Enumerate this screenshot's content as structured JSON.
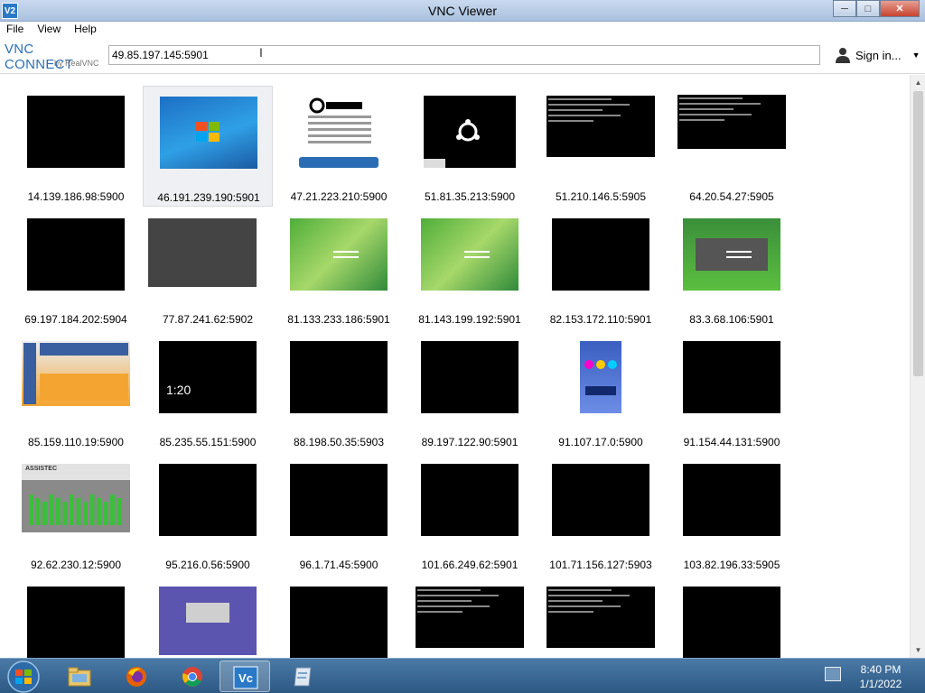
{
  "window": {
    "title": "VNC Viewer",
    "app_icon_text": "V2",
    "minimize_label": "─",
    "maximize_label": "□",
    "close_label": "✕"
  },
  "menu": [
    "File",
    "View",
    "Help"
  ],
  "logo": {
    "line1": "VNC CONNECT",
    "line2": "by RealVNC"
  },
  "address": {
    "value": "49.85.197.145:5901",
    "placeholder": ""
  },
  "account": {
    "signin_label": "Sign in...",
    "caret": "▼"
  },
  "thumbnails": [
    {
      "label": "14.139.186.98:5900",
      "screen": "black"
    },
    {
      "label": "46.191.239.190:5901",
      "screen": "windows7",
      "selected": true
    },
    {
      "label": "47.21.223.210:5900",
      "screen": "action-target"
    },
    {
      "label": "51.81.35.213:5900",
      "screen": "ubuntu"
    },
    {
      "label": "51.210.146.5:5905",
      "screen": "terminal"
    },
    {
      "label": "64.20.54.27:5905",
      "screen": "black-text"
    },
    {
      "label": "69.197.184.202:5904",
      "screen": "black"
    },
    {
      "label": "77.87.241.62:5902",
      "screen": "gray"
    },
    {
      "label": "81.133.233.186:5901",
      "screen": "green-abstract"
    },
    {
      "label": "81.143.199.192:5901",
      "screen": "green-abstract"
    },
    {
      "label": "82.153.172.110:5901",
      "screen": "black"
    },
    {
      "label": "83.3.68.106:5901",
      "screen": "green-panel"
    },
    {
      "label": "85.159.110.19:5900",
      "screen": "thermostat"
    },
    {
      "label": "85.235.55.151:5900",
      "screen": "lockscreen",
      "text": "1:20"
    },
    {
      "label": "88.198.50.35:5903",
      "screen": "black"
    },
    {
      "label": "89.197.122.90:5901",
      "screen": "black"
    },
    {
      "label": "91.107.17.0:5900",
      "screen": "phone"
    },
    {
      "label": "91.154.44.131:5900",
      "screen": "black"
    },
    {
      "label": "92.62.230.12:5900",
      "screen": "equalizer",
      "text": "ASSISTEC"
    },
    {
      "label": "95.216.0.56:5900",
      "screen": "black"
    },
    {
      "label": "96.1.71.45:5900",
      "screen": "black"
    },
    {
      "label": "101.66.249.62:5901",
      "screen": "black"
    },
    {
      "label": "101.71.156.127:5903",
      "screen": "black"
    },
    {
      "label": "103.82.196.33:5905",
      "screen": "black"
    },
    {
      "label": "",
      "screen": "black"
    },
    {
      "label": "",
      "screen": "purple"
    },
    {
      "label": "",
      "screen": "black"
    },
    {
      "label": "",
      "screen": "terminal"
    },
    {
      "label": "",
      "screen": "terminal"
    },
    {
      "label": "",
      "screen": "black"
    }
  ],
  "taskbar": {
    "apps": [
      "explorer-icon",
      "firefox-icon",
      "chrome-icon",
      "vnc-icon",
      "notepad-icon"
    ],
    "active_app": "vnc-icon",
    "time": "8:40 PM",
    "date": "1/1/2022"
  }
}
